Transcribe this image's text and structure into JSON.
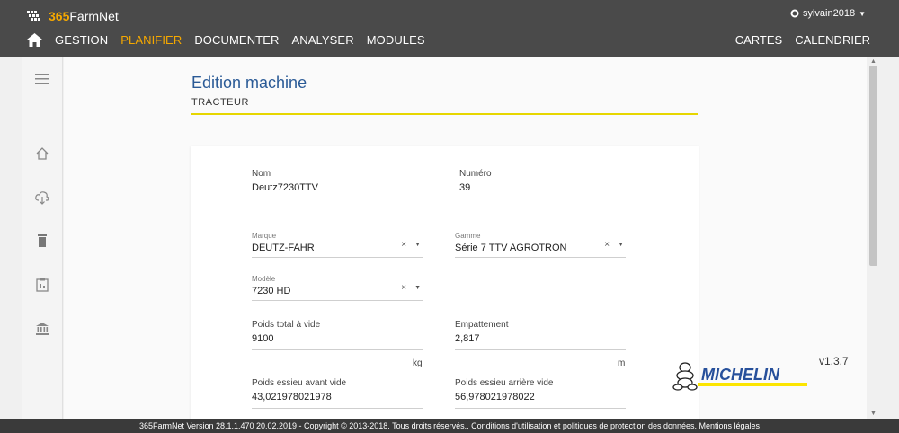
{
  "header": {
    "logo_num": "365",
    "logo_text": "FarmNet",
    "user": "sylvain2018",
    "nav": [
      "GESTION",
      "PLANIFIER",
      "DOCUMENTER",
      "ANALYSER",
      "MODULES"
    ],
    "nav_right": [
      "CARTES",
      "CALENDRIER"
    ],
    "active_color": "#f5a800"
  },
  "sidebar": {
    "icons": [
      "menu-icon",
      "home-icon",
      "cloud-download-icon",
      "trash-icon",
      "clipboard-icon",
      "bank-icon"
    ]
  },
  "page": {
    "title": "Edition machine",
    "subtitle": "TRACTEUR"
  },
  "form": {
    "nom": {
      "label": "Nom",
      "value": "Deutz7230TTV"
    },
    "numero": {
      "label": "Numéro",
      "value": "39"
    },
    "marque": {
      "label": "Marque",
      "value": "DEUTZ-FAHR"
    },
    "gamme": {
      "label": "Gamme",
      "value": "Série 7 TTV AGROTRON"
    },
    "modele": {
      "label": "Modèle",
      "value": "7230 HD"
    },
    "poids_total": {
      "label": "Poids total à vide",
      "value": "9100",
      "unit": "kg"
    },
    "empattement": {
      "label": "Empattement",
      "value": "2,817",
      "unit": "m"
    },
    "poids_avant": {
      "label": "Poids essieu avant vide",
      "value": "43,021978021978"
    },
    "poids_arriere": {
      "label": "Poids essieu arrière vide",
      "value": "56,978021978022"
    },
    "clear_symbol": "×"
  },
  "michelin": {
    "text": "MICHELIN"
  },
  "version": "v1.3.7",
  "footer": {
    "text": "365FarmNet Version 28.1.1.470 20.02.2019 - Copyright © 2013-2018. Tous droits réservés.. ",
    "link1": "Conditions d'utilisation et politiques de protection des données.",
    "link2": " Mentions légales"
  }
}
